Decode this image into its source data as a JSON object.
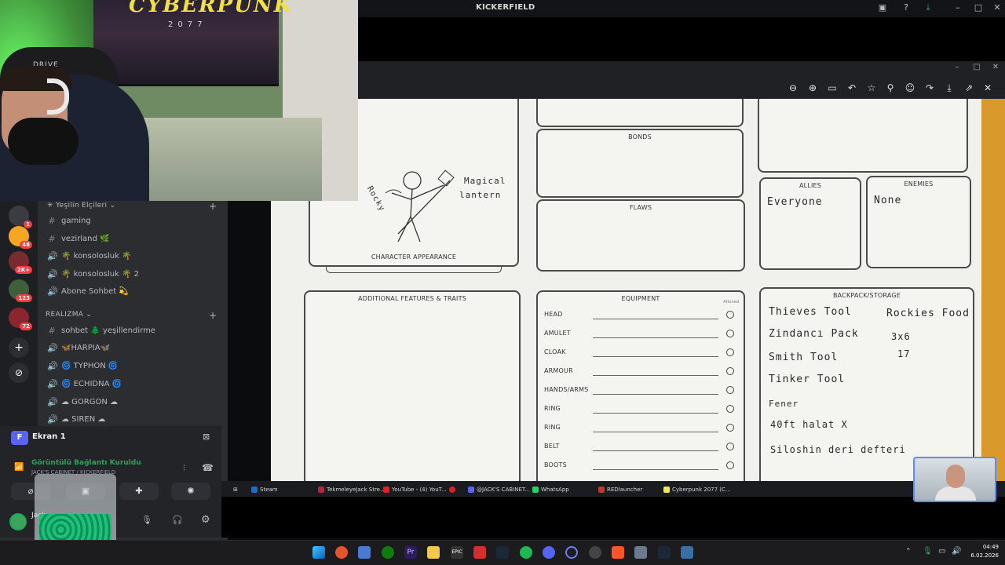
{
  "viewer": {
    "window_title": "KICKERFIELD",
    "toolbar_icons": [
      "zoom-out-icon",
      "zoom-in-icon",
      "fit-icon",
      "undo-icon",
      "star-icon",
      "pin-icon",
      "emoji-icon",
      "share-icon",
      "download-icon",
      "open-external-icon",
      "close-icon"
    ]
  },
  "sheet": {
    "bonds": "BONDS",
    "flaws": "FLAWS",
    "allies": "ALLIES",
    "enemies": "ENEMIES",
    "character_appearance": "CHARACTER APPEARANCE",
    "additional_features": "ADDITIONAL FEATURES & TRAITS",
    "equipment": "EQUIPMENT",
    "attuned": "Attuned",
    "backpack": "BACKPACK/STORAGE",
    "allies_hand": "Everyone",
    "enemies_hand": "None",
    "drawing_label_1": "Magical",
    "drawing_label_2": "lantern",
    "drawing_label_3": "Rocky",
    "equipment_slots": [
      "HEAD",
      "AMULET",
      "CLOAK",
      "ARMOUR",
      "HANDS/ARMS",
      "RING",
      "RING",
      "BELT",
      "BOOTS"
    ],
    "backpack_items_left": [
      "Thieves Tool",
      "Zindancı Pack",
      "Smith Tool",
      "Tinker Tool",
      "Fener",
      "40ft halat X",
      "Siloshin deri defteri"
    ],
    "backpack_items_right": [
      "Rockies Food",
      "3x6",
      "17"
    ]
  },
  "discord": {
    "server_badges": [
      "1",
      "48",
      "2K+",
      "123",
      "72"
    ],
    "category_top": "Yeşilin Elçileri",
    "channels_top": [
      {
        "sym": "#",
        "name": "gaming"
      },
      {
        "sym": "#",
        "name": "vezirland 🌿"
      },
      {
        "sym": "🔊",
        "name": "🌴 konsolosluk 🌴"
      },
      {
        "sym": "🔊",
        "name": "🌴 konsolosluk 🌴 2"
      },
      {
        "sym": "🔊",
        "name": "Abone Sohbet 💫"
      }
    ],
    "category_2": "REALIZMA",
    "channels_2": [
      {
        "sym": "#",
        "name": "sohbet 🌲 yeşillendirme"
      },
      {
        "sym": "🔊",
        "name": "🦋HARPIA🦋"
      },
      {
        "sym": "🔊",
        "name": "🌀 TYPHON 🌀"
      },
      {
        "sym": "🔊",
        "name": "🌀 ECHIDNA 🌀"
      },
      {
        "sym": "🔊",
        "name": "☁ GORGON ☁"
      },
      {
        "sym": "🔊",
        "name": "☁ SIREN ☁"
      }
    ],
    "screen_label": "Ekran 1",
    "screen_initial": "F",
    "connection_status": "Görüntülü Bağlantı Kuruldu",
    "connection_sub": "JACK'S CABINET / KICKERFIELD",
    "user_name": "Jack"
  },
  "stream_taskbar": [
    "Steam",
    "TekmeleyeJack Stre...",
    "YouTube - (4) YouT...",
    "@JACK'S CABINET...",
    "WhatsApp",
    "REDlauncher",
    "Cyberpunk 2077 (C..."
  ],
  "webcam": {
    "poster_text": "CYBERPUNK",
    "poster_sub": "2077",
    "chair_brand": "DRIVE"
  },
  "clock": {
    "time": "04:49",
    "date": "6.02.2026"
  },
  "colors": {
    "discord_bg": "#2b2d31",
    "accent": "#5865f2",
    "paper": "#f0f0ec"
  }
}
